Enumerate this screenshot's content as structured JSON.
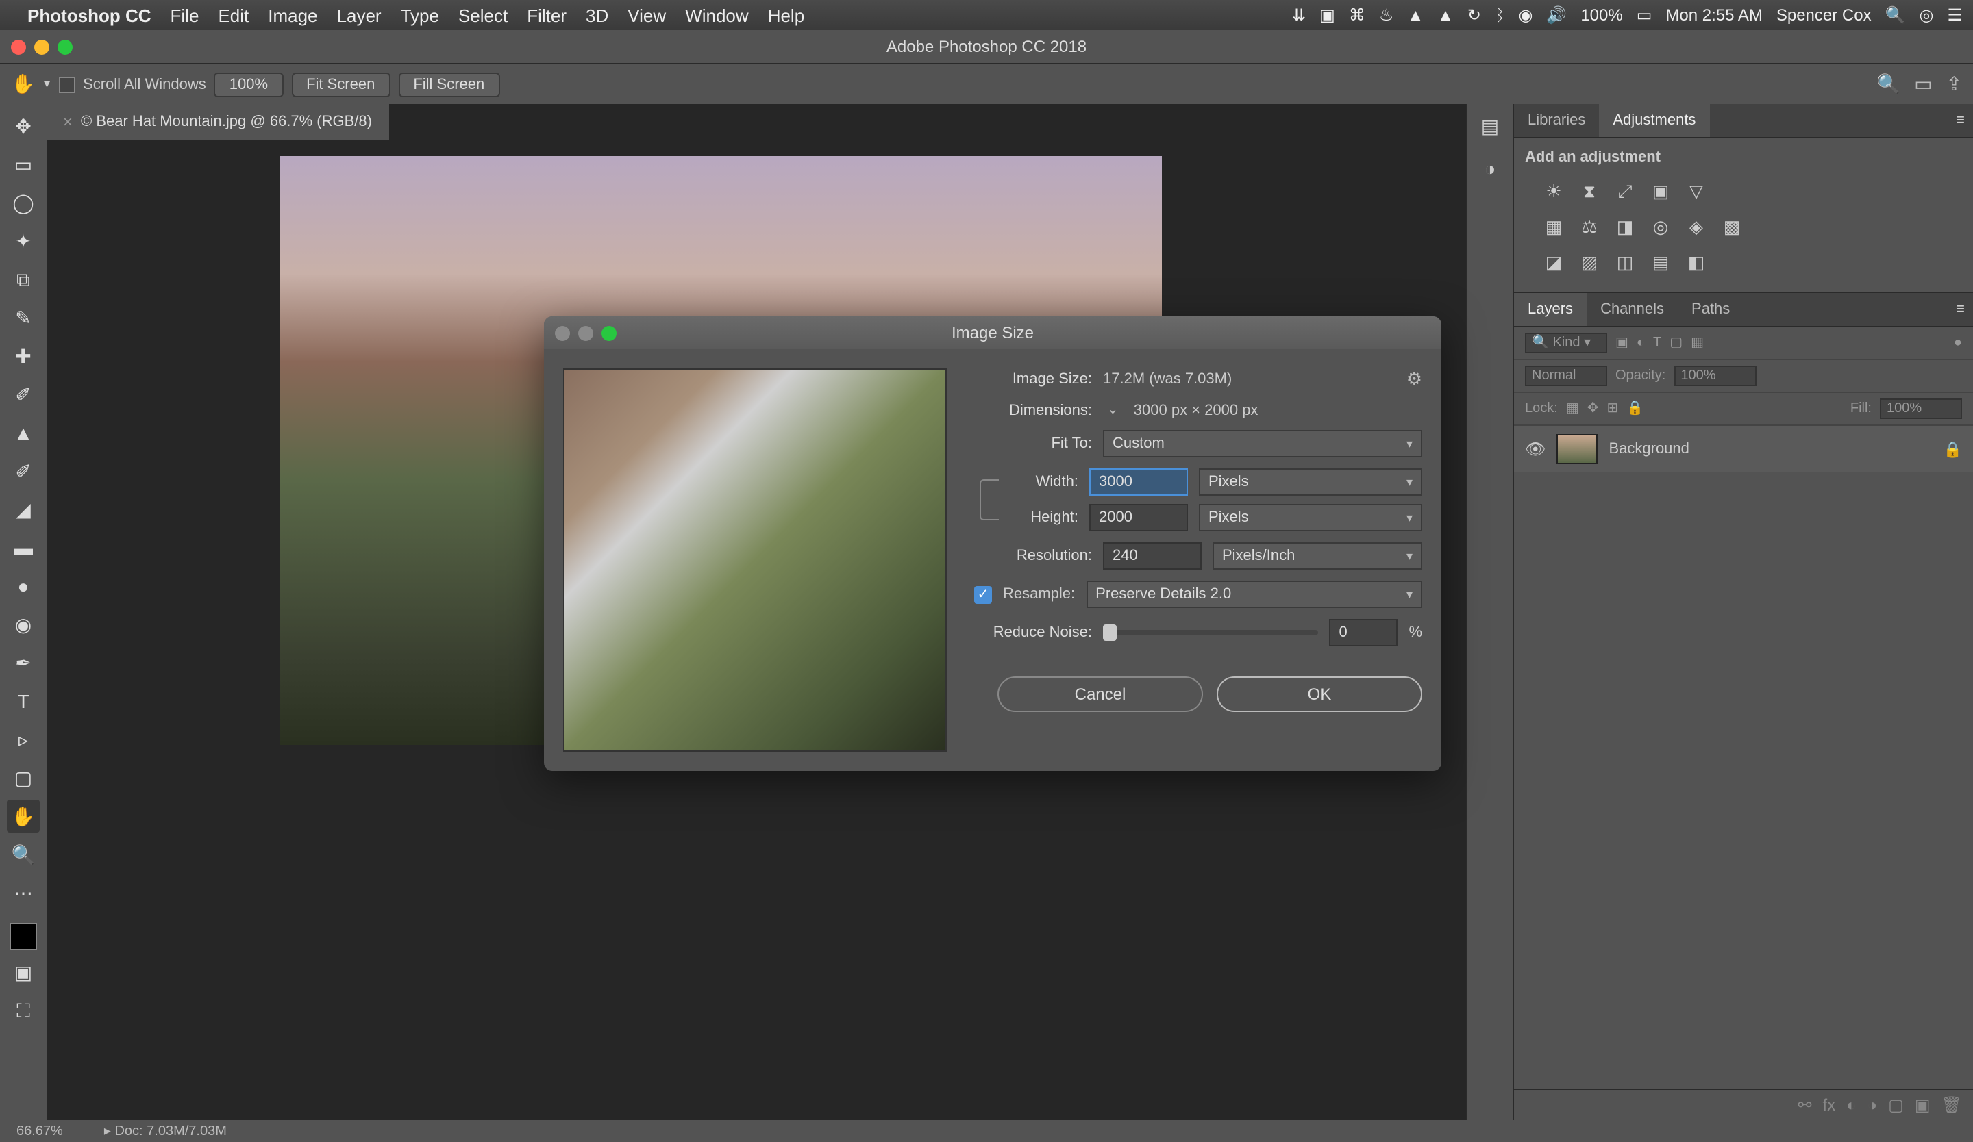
{
  "menubar": {
    "app_name": "Photoshop CC",
    "items": [
      "File",
      "Edit",
      "Image",
      "Layer",
      "Type",
      "Select",
      "Filter",
      "3D",
      "View",
      "Window",
      "Help"
    ],
    "battery": "100%",
    "clock": "Mon 2:55 AM",
    "user": "Spencer Cox"
  },
  "titlebar": {
    "title": "Adobe Photoshop CC 2018"
  },
  "optbar": {
    "scroll_all": "Scroll All Windows",
    "zoom": "100%",
    "fit": "Fit Screen",
    "fill": "Fill Screen"
  },
  "document": {
    "tab": "© Bear Hat Mountain.jpg @ 66.7% (RGB/8)"
  },
  "adjust_panel": {
    "tab_libraries": "Libraries",
    "tab_adjust": "Adjustments",
    "heading": "Add an adjustment"
  },
  "layers_panel": {
    "tab_layers": "Layers",
    "tab_channels": "Channels",
    "tab_paths": "Paths",
    "kind_label": "Kind",
    "blend": "Normal",
    "opacity_lbl": "Opacity:",
    "opacity_val": "100%",
    "lock_lbl": "Lock:",
    "fill_lbl": "Fill:",
    "fill_val": "100%",
    "layer_name": "Background"
  },
  "status": {
    "zoom": "66.67%",
    "doc": "Doc: 7.03M/7.03M"
  },
  "dialog": {
    "title": "Image Size",
    "image_size_lbl": "Image Size:",
    "image_size_val": "17.2M (was 7.03M)",
    "dimensions_lbl": "Dimensions:",
    "dimensions_val": "3000 px  ×  2000 px",
    "fit_to_lbl": "Fit To:",
    "fit_to_val": "Custom",
    "width_lbl": "Width:",
    "width_val": "3000",
    "height_lbl": "Height:",
    "height_val": "2000",
    "wh_unit": "Pixels",
    "res_lbl": "Resolution:",
    "res_val": "240",
    "res_unit": "Pixels/Inch",
    "resample_lbl": "Resample:",
    "resample_val": "Preserve Details 2.0",
    "noise_lbl": "Reduce Noise:",
    "noise_val": "0",
    "noise_unit": "%",
    "cancel": "Cancel",
    "ok": "OK"
  },
  "tools": [
    "↔",
    "▭",
    "◯",
    "✦",
    "⧈",
    "✎",
    "⌕",
    "✚",
    "✐",
    "◢",
    "⛶",
    "⬢",
    "◆",
    "●",
    "◉",
    "✒",
    "T",
    "▹",
    "▢",
    "✋",
    "🔍"
  ]
}
